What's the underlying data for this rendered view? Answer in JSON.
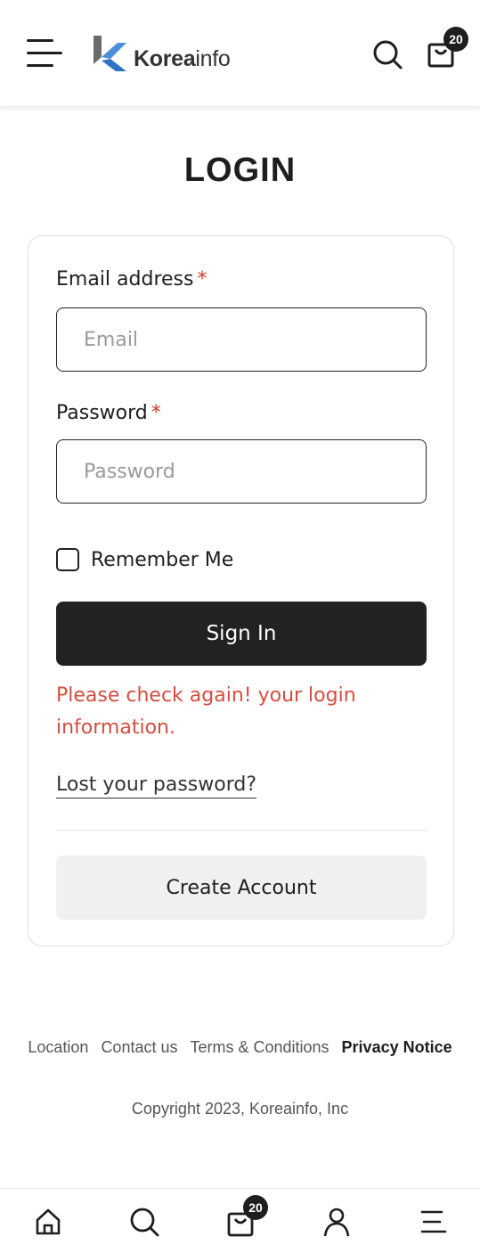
{
  "header": {
    "logo_text_bold": "Korea",
    "logo_text_light": "info",
    "cart_count": "20",
    "menu_icon": "hamburger-icon",
    "search_icon": "search-icon",
    "cart_icon": "shopping-bag-icon"
  },
  "page": {
    "title": "LOGIN"
  },
  "form": {
    "email_label": "Email address",
    "email_placeholder": "Email",
    "password_label": "Password",
    "password_placeholder": "Password",
    "required_mark": "*",
    "remember_label": "Remember Me",
    "remember_checked": false,
    "signin_label": "Sign In",
    "error_message": "Please check again! your login information.",
    "lost_password": "Lost your password?",
    "create_account": "Create Account"
  },
  "footer": {
    "links": [
      "Location",
      "Contact us",
      "Terms & Conditions",
      "Privacy Notice"
    ],
    "copyright": "Copyright 2023, Koreainfo, Inc"
  },
  "bottom_nav": {
    "items": [
      "home-icon",
      "search-icon",
      "shopping-bag-icon",
      "user-icon",
      "menu-icon"
    ],
    "cart_count": "20"
  },
  "colors": {
    "primary": "#222222",
    "error": "#d64d3e",
    "required": "#d0392b",
    "logo_blue": "#4a90d9",
    "logo_gray": "#6b6b6b"
  }
}
